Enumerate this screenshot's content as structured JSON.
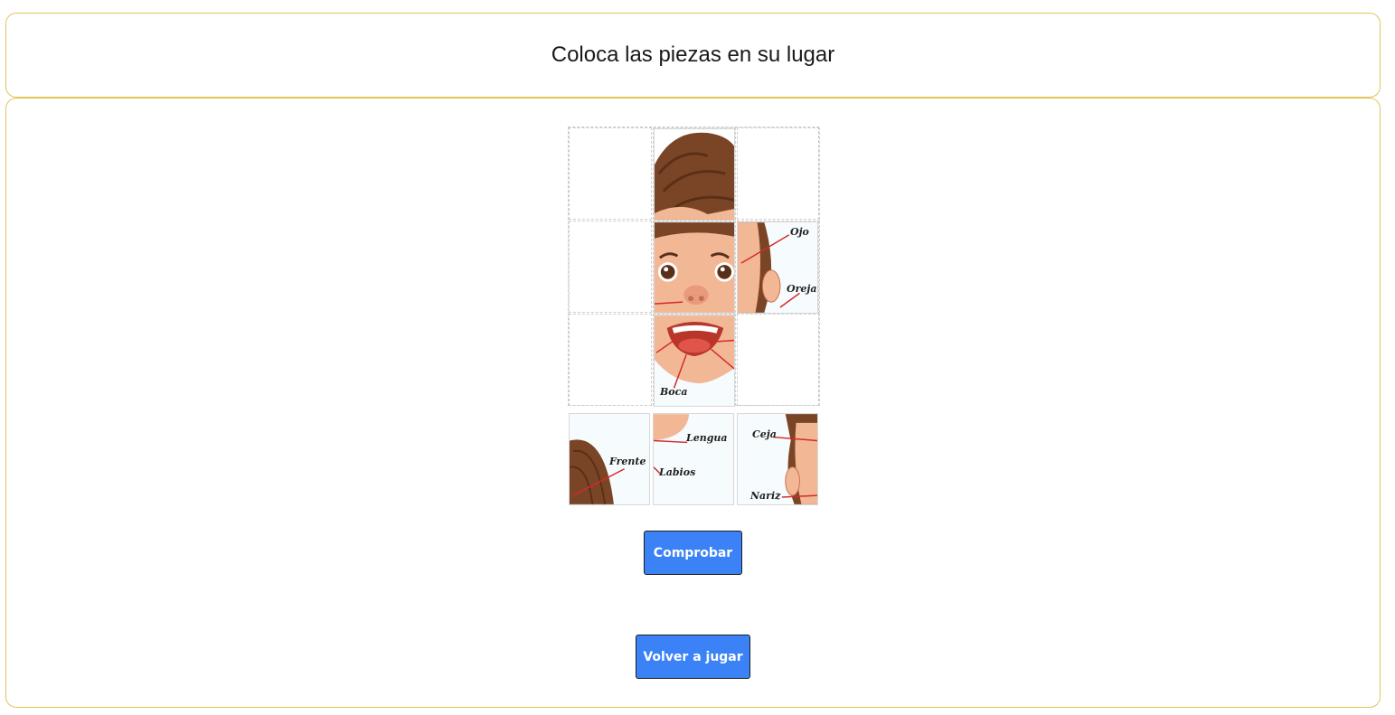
{
  "header": {
    "title": "Coloca las piezas en su lugar"
  },
  "board": {
    "labels": {
      "ojo": "Ojo",
      "oreja": "Oreja",
      "boca": "Boca",
      "frente": "Frente",
      "lengua": "Lengua",
      "labios": "Labios",
      "ceja": "Ceja",
      "nariz": "Nariz"
    }
  },
  "buttons": {
    "check": "Comprobar",
    "replay": "Volver a jugar"
  },
  "colors": {
    "accent": "#3b82f6",
    "panel_border": "#e2c55a",
    "label_line": "#d42a2a",
    "hair": "#7a4526",
    "skin": "#f2b896"
  }
}
